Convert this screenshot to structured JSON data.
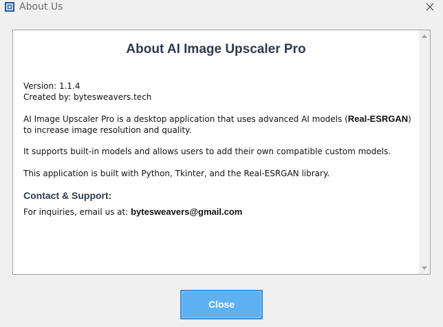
{
  "window": {
    "title": "About Us"
  },
  "icons": {
    "app": "app-icon",
    "close": "close-icon",
    "scroll_up": "scroll-up-arrow-icon",
    "scroll_down": "scroll-down-arrow-icon"
  },
  "content": {
    "heading": "About AI Image Upscaler Pro",
    "version": "Version: 1.1.4",
    "created_by": "Created by: bytesweavers.tech",
    "description_prefix": "AI Image Upscaler Pro is a desktop application that uses advanced AI models (",
    "description_bold": "Real-ESRGAN",
    "description_suffix": ")",
    "description_line2": "to increase image resolution and quality.",
    "models_text": "It supports built-in models and allows users to add their own compatible custom models.",
    "built_with": "This application is built with Python, Tkinter, and the Real-ESRGAN library.",
    "contact_heading": "Contact & Support:",
    "inquiries_prefix": "For inquiries, email us at: ",
    "email": "bytesweavers@gmail.com"
  },
  "buttons": {
    "close_label": "Close"
  },
  "colors": {
    "heading": "#2e3a4f",
    "button_bg": "#5db1f3",
    "button_border": "#3a8fd6"
  }
}
